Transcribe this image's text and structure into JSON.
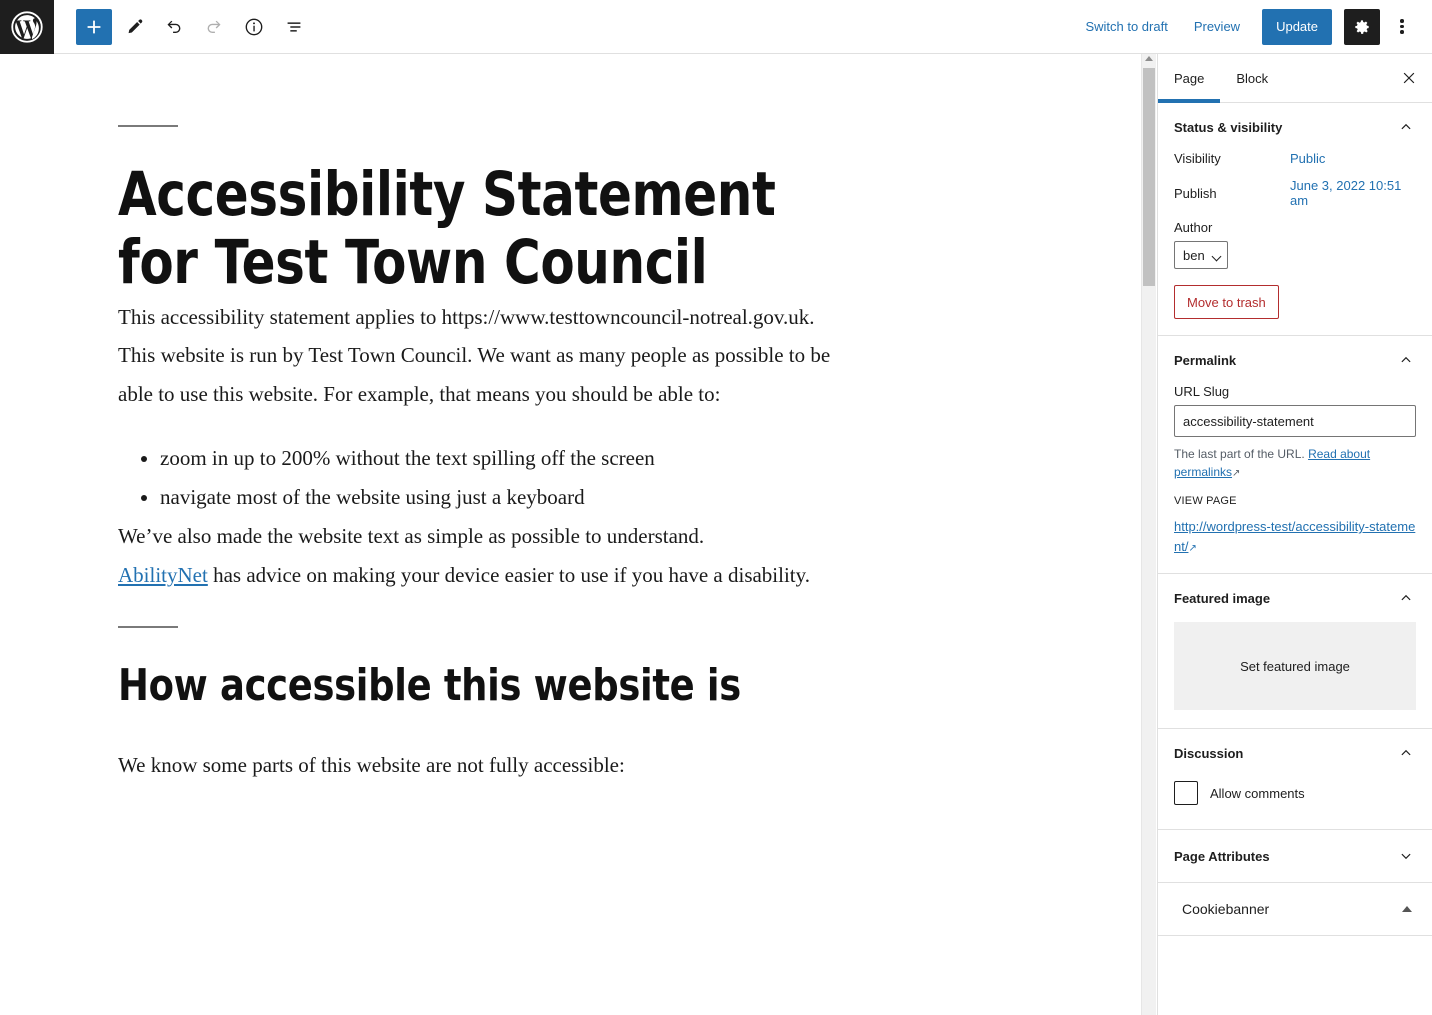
{
  "topbar": {
    "logo_icon": "wordpress-logo-icon",
    "tools": [
      {
        "name": "add-block-button",
        "icon": "plus-icon",
        "label": "Toggle block inserter",
        "state": "active"
      },
      {
        "name": "edit-tool-button",
        "icon": "pencil-icon",
        "label": "Tools",
        "state": "default"
      },
      {
        "name": "undo-button",
        "icon": "undo-icon",
        "label": "Undo",
        "state": "default"
      },
      {
        "name": "redo-button",
        "icon": "redo-icon",
        "label": "Redo",
        "state": "disabled"
      },
      {
        "name": "details-button",
        "icon": "info-icon",
        "label": "Details",
        "state": "default"
      },
      {
        "name": "list-view-button",
        "icon": "list-view-icon",
        "label": "List view",
        "state": "default"
      }
    ],
    "switch_to_draft": "Switch to draft",
    "preview": "Preview",
    "update": "Update",
    "settings_icon": "gear-icon",
    "options_icon": "kebab-menu-icon"
  },
  "document": {
    "separator_top": "separator",
    "title": "Accessibility Statement for Test Town Council",
    "paragraph_1": "This accessibility statement applies to https://www.testtowncouncil-notreal.gov.uk.",
    "paragraph_2": "This website is run by Test Town Council. We want as many people as possible to be able to use this website. For example, that means you should be able to:",
    "list_items": [
      "zoom in up to 200% without the text spilling off the screen",
      "navigate most of the website using just a keyboard"
    ],
    "paragraph_3": "We’ve also made the website text as simple as possible to understand.",
    "paragraph_4_link": "AbilityNet",
    "paragraph_4_rest": " has advice on making your device easier to use if you have a disability.",
    "separator_mid": "separator",
    "heading_2": "How accessible this website is",
    "paragraph_5": "We know some parts of this website are not fully accessible:"
  },
  "sidebar": {
    "tabs": [
      {
        "label": "Page",
        "active": true
      },
      {
        "label": "Block",
        "active": false
      }
    ],
    "close_icon": "close-icon",
    "status_visibility": {
      "title": "Status & visibility",
      "collapse_icon": "chevron-up-icon",
      "visibility_label": "Visibility",
      "visibility_value": "Public",
      "publish_label": "Publish",
      "publish_value": "June 3, 2022 10:51 am",
      "author_label": "Author",
      "author_value": "ben",
      "author_options": [
        "ben"
      ],
      "trash_label": "Move to trash"
    },
    "permalink": {
      "title": "Permalink",
      "collapse_icon": "chevron-up-icon",
      "slug_label": "URL Slug",
      "slug_value": "accessibility-statement",
      "help_prefix": "The last part of the URL. ",
      "help_link": "Read about permalinks",
      "view_page_label": "VIEW PAGE",
      "view_page_url": "http://wordpress-test/accessibility-statement/"
    },
    "featured_image": {
      "title": "Featured image",
      "collapse_icon": "chevron-up-icon",
      "set_label": "Set featured image"
    },
    "discussion": {
      "title": "Discussion",
      "collapse_icon": "chevron-up-icon",
      "allow_comments_label": "Allow comments",
      "allow_comments_checked": false
    },
    "page_attributes": {
      "title": "Page Attributes",
      "collapse_icon": "chevron-down-icon"
    },
    "cookiebanner": {
      "title": "Cookiebanner",
      "collapse_icon": "triangle-up-icon"
    }
  },
  "colors": {
    "accent_blue": "#2271b1",
    "dark": "#1e1e1e",
    "danger_red": "#b32d2e",
    "border": "#e0e0e0"
  }
}
